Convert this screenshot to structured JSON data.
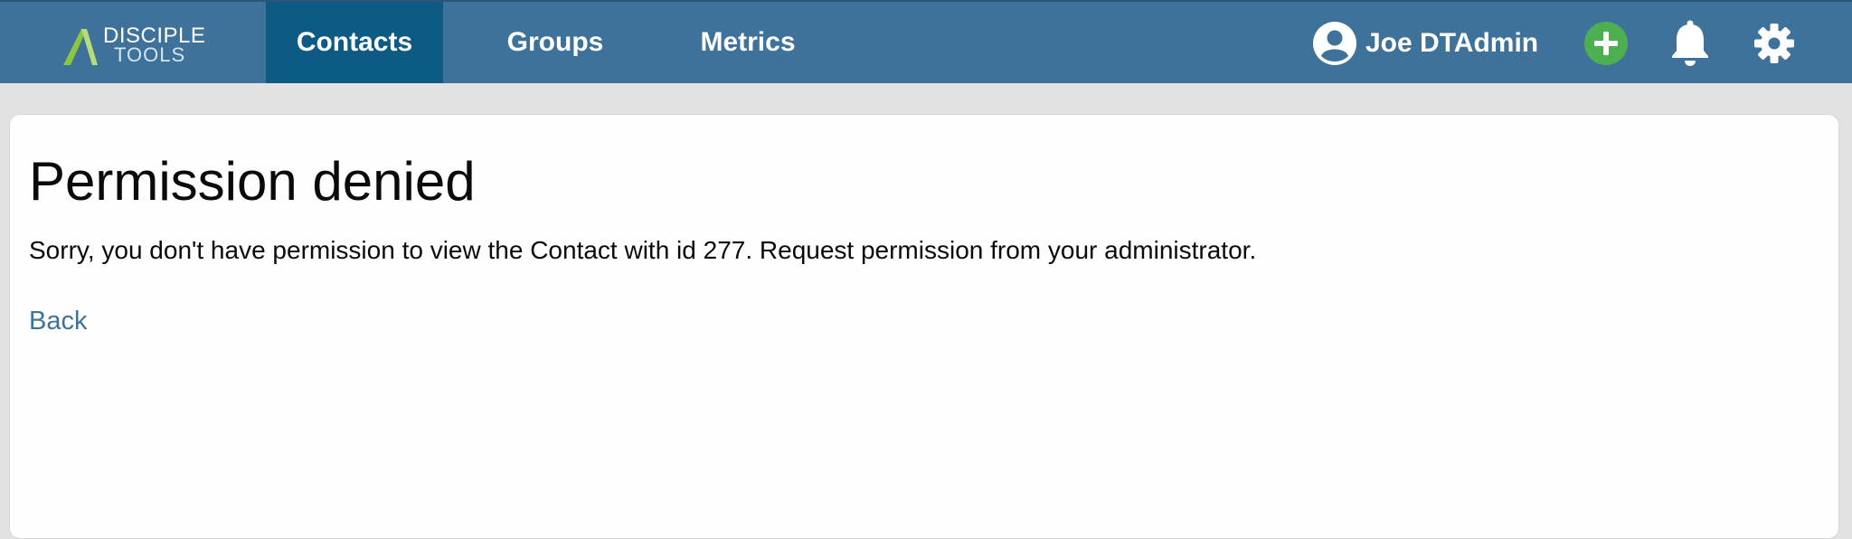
{
  "header": {
    "logo": {
      "line1": "DISCIPLE",
      "line2": "TOOLS",
      "icon": "disciple-tools-logo-icon"
    },
    "nav": [
      {
        "label": "Contacts",
        "active": true
      },
      {
        "label": "Groups",
        "active": false
      },
      {
        "label": "Metrics",
        "active": false
      }
    ],
    "user": {
      "name": "Joe DTAdmin",
      "icon": "user-avatar-icon"
    },
    "actions": {
      "add_icon": "plus-circle-icon",
      "notifications_icon": "bell-icon",
      "settings_icon": "gear-icon"
    }
  },
  "main": {
    "title": "Permission denied",
    "message": "Sorry, you don't have permission to view the Contact with id 277. Request permission from your administrator.",
    "back_label": "Back"
  },
  "colors": {
    "header_bg": "#3f729b",
    "nav_active_bg": "#0d5a85",
    "add_button": "#4caf50",
    "link": "#3f729b",
    "page_bg": "#e2e2e2"
  }
}
